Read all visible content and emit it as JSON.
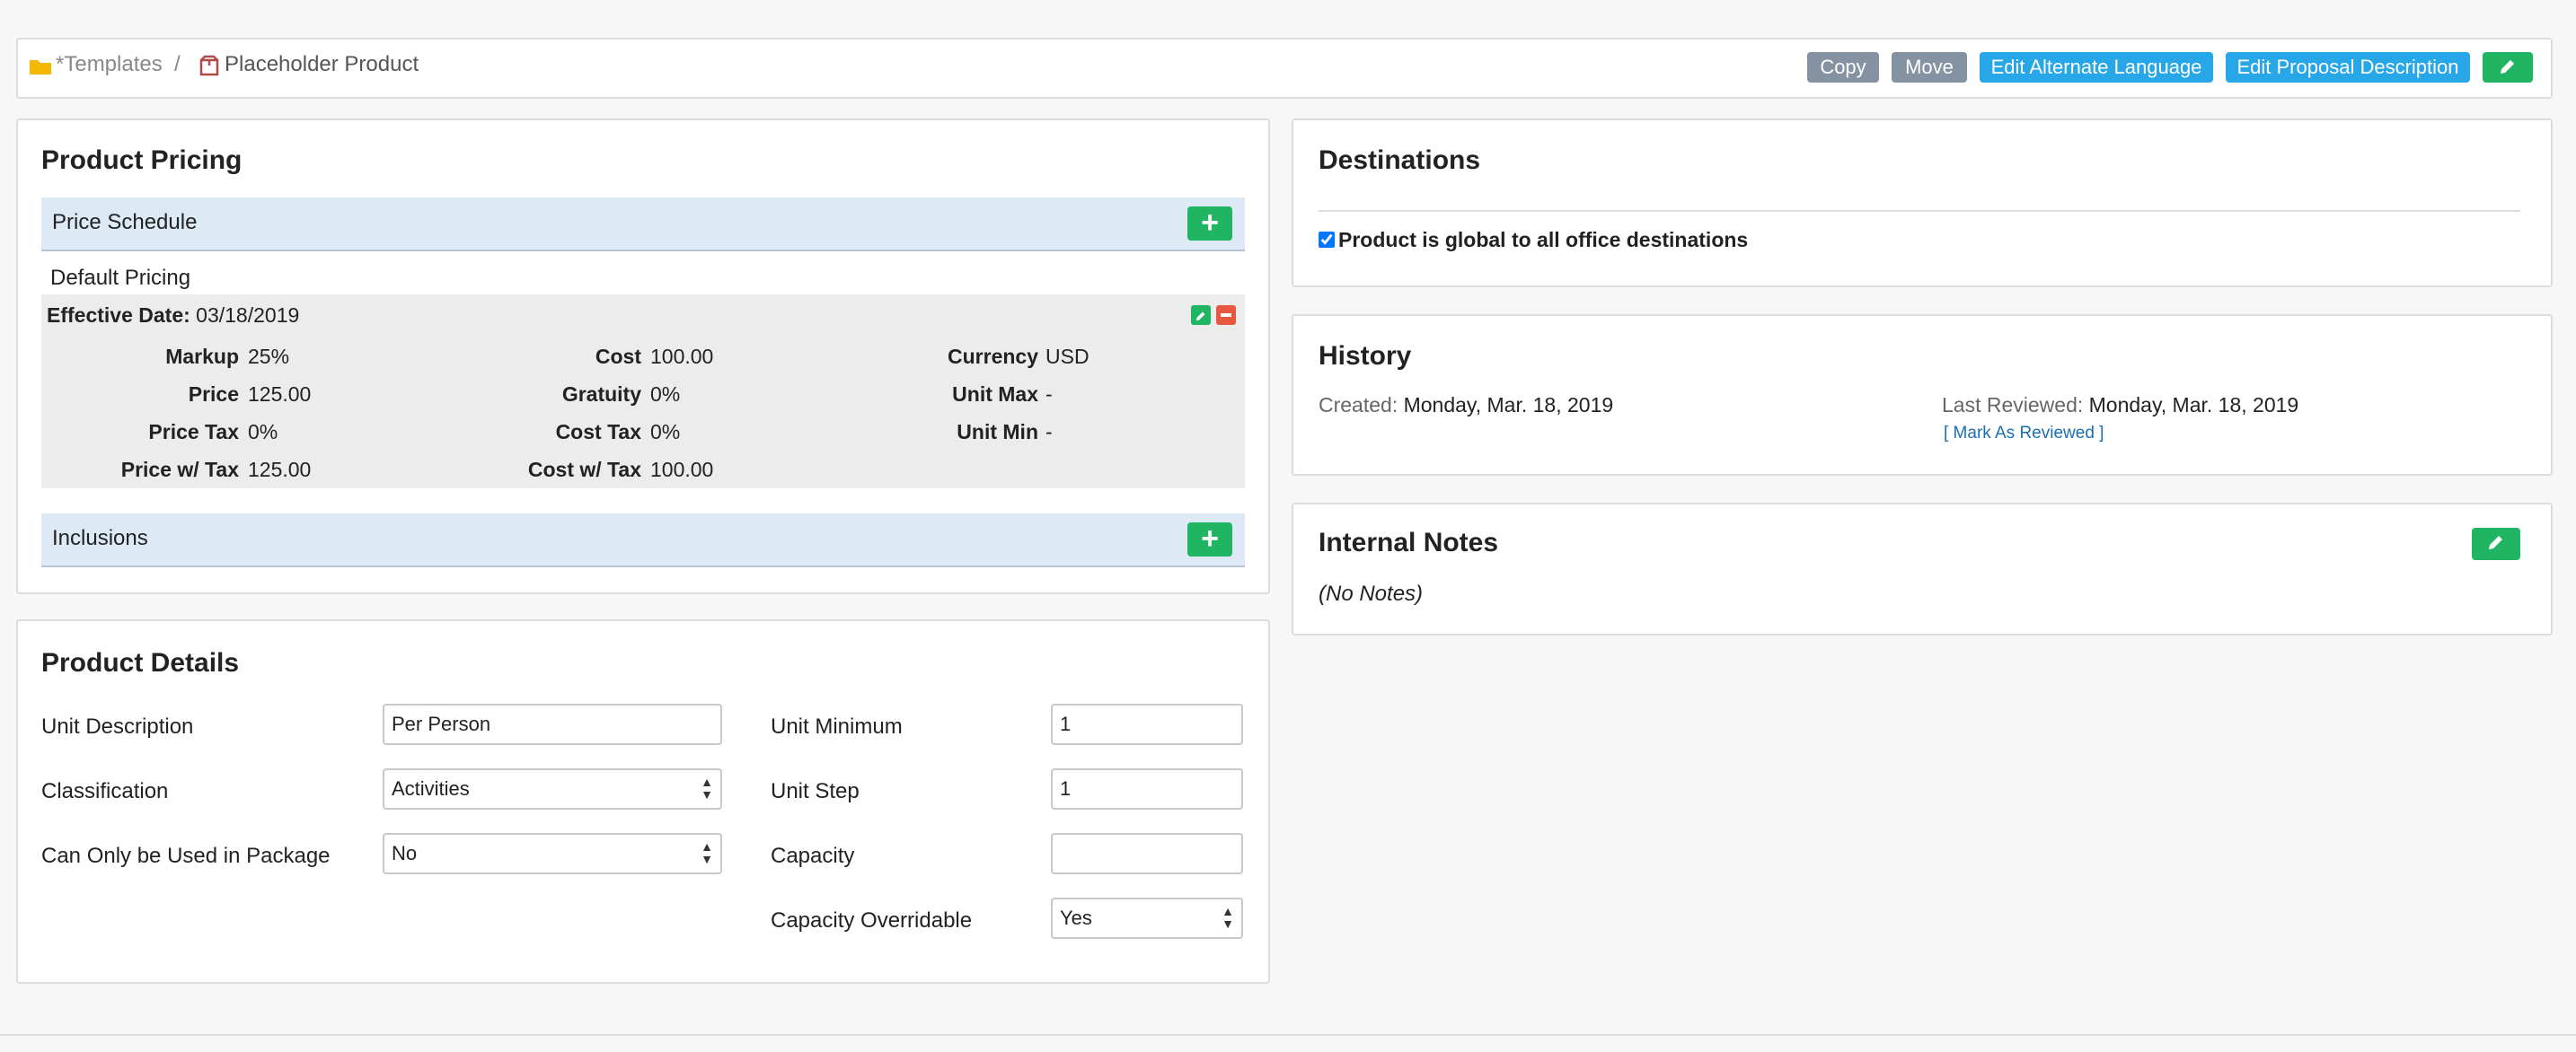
{
  "breadcrumb": {
    "folder_label": "*Templates",
    "separator": "/",
    "product_label": "Placeholder Product"
  },
  "toolbar": {
    "copy_label": "Copy",
    "move_label": "Move",
    "alt_lang_label": "Edit Alternate Language",
    "proposal_label": "Edit Proposal Description"
  },
  "pricing": {
    "title": "Product Pricing",
    "schedule_label": "Price Schedule",
    "default_label": "Default Pricing",
    "effective_label": "Effective Date:",
    "effective_value": "03/18/2019",
    "rows": {
      "markup_label": "Markup",
      "markup_value": "25%",
      "price_label": "Price",
      "price_value": "125.00",
      "price_tax_label": "Price Tax",
      "price_tax_value": "0%",
      "price_wtax_label": "Price w/ Tax",
      "price_wtax_value": "125.00",
      "cost_label": "Cost",
      "cost_value": "100.00",
      "gratuity_label": "Gratuity",
      "gratuity_value": "0%",
      "cost_tax_label": "Cost Tax",
      "cost_tax_value": "0%",
      "cost_wtax_label": "Cost w/ Tax",
      "cost_wtax_value": "100.00",
      "currency_label": "Currency",
      "currency_value": "USD",
      "unit_max_label": "Unit Max",
      "unit_max_value": "-",
      "unit_min_label": "Unit Min",
      "unit_min_value": "-"
    },
    "inclusions_label": "Inclusions"
  },
  "details": {
    "title": "Product Details",
    "unit_description_label": "Unit Description",
    "unit_description_value": "Per Person",
    "classification_label": "Classification",
    "classification_value": "Activities",
    "package_only_label": "Can Only be Used in Package",
    "package_only_value": "No",
    "unit_minimum_label": "Unit Minimum",
    "unit_minimum_value": "1",
    "unit_step_label": "Unit Step",
    "unit_step_value": "1",
    "capacity_label": "Capacity",
    "capacity_value": "",
    "capacity_overridable_label": "Capacity Overridable",
    "capacity_overridable_value": "Yes"
  },
  "destinations": {
    "title": "Destinations",
    "global_label": "Product is global to all office destinations",
    "global_checked": true
  },
  "history": {
    "title": "History",
    "created_label": "Created:",
    "created_value": "Monday, Mar. 18, 2019",
    "reviewed_label": "Last Reviewed:",
    "reviewed_value": "Monday, Mar. 18, 2019",
    "mark_reviewed_label": "[ Mark As Reviewed ]"
  },
  "notes": {
    "title": "Internal Notes",
    "empty_text": "(No Notes)"
  },
  "colors": {
    "accent_green": "#1fb563",
    "accent_blue": "#27a7e8",
    "button_gray": "#8592a1",
    "delete_red": "#e8573f",
    "folder_yellow": "#f5b800"
  }
}
